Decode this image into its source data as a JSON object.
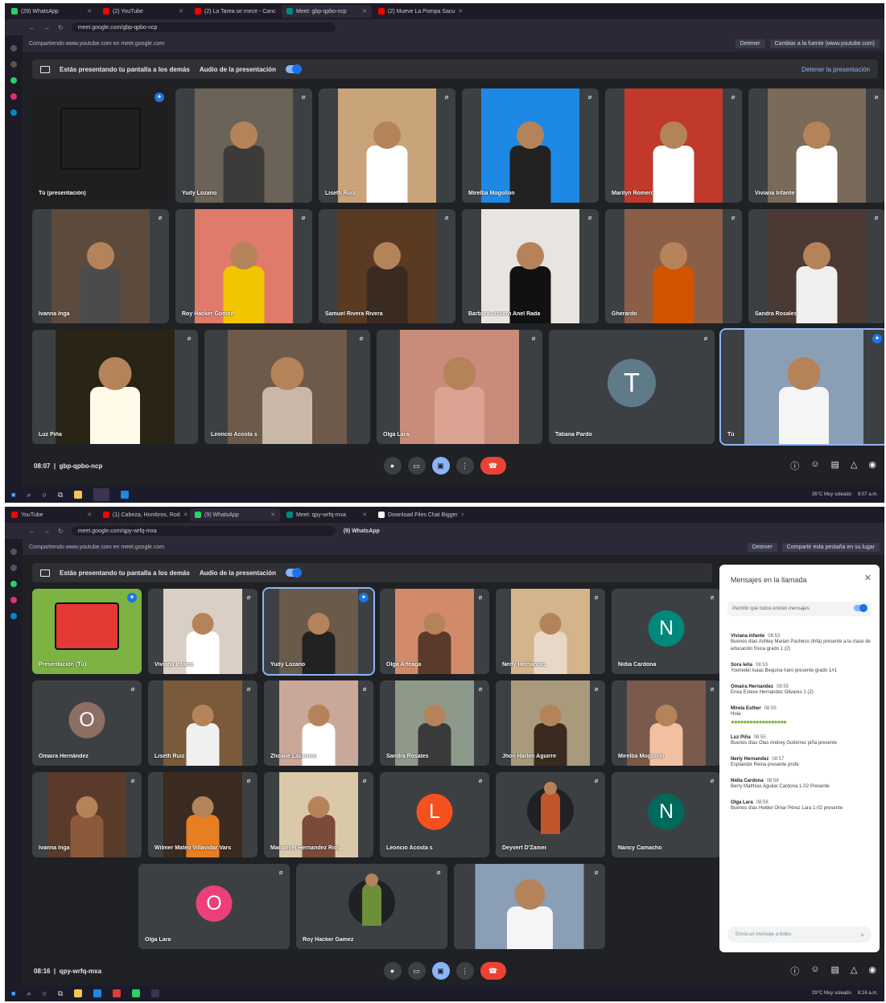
{
  "top": {
    "tabs": [
      {
        "label": "(29) WhatsApp",
        "color": "#25d366"
      },
      {
        "label": "(2) YouTube",
        "color": "#ff0000"
      },
      {
        "label": "(2) La Tarea se mece - Canc",
        "color": "#ff0000"
      },
      {
        "label": "Meet: gbp-qpbo-ncp",
        "color": "#00897b",
        "active": true
      },
      {
        "label": "(2) Mueve La Pompa Sacu",
        "color": "#ff0000"
      }
    ],
    "url": "meet.google.com/gbp-qpbo-ncp",
    "sharing_text": "Compartiendo www.youtube.com en meet.google.com",
    "stop_label": "Detener",
    "switch_label": "Cambiar a la fuente (www.youtube.com)",
    "presenting_text": "Estás presentando tu pantalla a los demás",
    "audio_text": "Audio de la presentación",
    "stop_presenting": "Detener la presentación",
    "tiles": [
      {
        "name": "Tú (presentación)",
        "bg": "#1f1f1f",
        "present": true,
        "pin": true
      },
      {
        "name": "Yudy Lozano",
        "bg": "#6b6258",
        "fig": "#3d3b39"
      },
      {
        "name": "Liseth Ruiz",
        "bg": "#c9a37a",
        "fig": "#ffffff"
      },
      {
        "name": "Mirelba Mogollon",
        "bg": "#1e88e5",
        "fig": "#222222"
      },
      {
        "name": "Marilyn Romero",
        "bg": "#c0392b",
        "fig": "#ffffff"
      },
      {
        "name": "Viviana Infante",
        "bg": "#7a6a5a",
        "fig": "#ffffff"
      },
      {
        "name": "Ivanna Inga",
        "bg": "#5c4b3d",
        "fig": "#4b4b4b"
      },
      {
        "name": "Roy Hacker Gomez",
        "bg": "#e07a6a",
        "fig": "#f2c500"
      },
      {
        "name": "Samuel Rivera Rivera",
        "bg": "#5b3a22",
        "fig": "#3a2a20"
      },
      {
        "name": "Barbara Lisbeth Anel Rada",
        "bg": "#e8e4df",
        "fig": "#111111"
      },
      {
        "name": "Gherardo",
        "bg": "#8b5e48",
        "fig": "#d35400"
      },
      {
        "name": "Sandra Rosales",
        "bg": "#4a3a33",
        "fig": "#f0f0f0"
      },
      {
        "name": "Luz Piña",
        "bg": "#2a2416",
        "fig": "#fffbe8"
      },
      {
        "name": "Leoncio Acosta s",
        "bg": "#6d5a4a",
        "fig": "#c9b8a8"
      },
      {
        "name": "Olga Lara",
        "bg": "#c98b7a",
        "fig": "#dba391"
      },
      {
        "name": "Tatiana Pardo",
        "avatar": "T",
        "avatar_color": "#5f7b88"
      },
      {
        "name": "Tú",
        "bg": "#8a9fb5",
        "fig": "#f5f5f5",
        "pin": true,
        "highlight": true
      }
    ],
    "meeting_time": "08:07",
    "meeting_code": "gbp-qpbo-ncp",
    "tray_text": "26°C  Muy soleado",
    "clock": "8:07 a.m."
  },
  "bottom": {
    "tabs": [
      {
        "label": "YouTube",
        "color": "#ff0000"
      },
      {
        "label": "(1) Cabeza, Hombros, Rod",
        "color": "#ff0000"
      },
      {
        "label": "(9) WhatsApp",
        "color": "#25d366",
        "active": true
      },
      {
        "label": "Meet: qpy-wrfq-mxa",
        "color": "#00897b"
      },
      {
        "label": "Download Files Chat Bigger",
        "color": "#ffffff"
      }
    ],
    "tab_tooltip": "(9) WhatsApp",
    "url": "meet.google.com/qpy-wrfq-mxa",
    "sharing_text": "Compartiendo www.youtube.com en meet.google.com",
    "stop_label": "Detener",
    "switch_label": "Compartir esta pestaña en su lugar",
    "presenting_text": "Estás presentando tu pantalla a los demás",
    "audio_text": "Audio de la presentación",
    "tiles": [
      {
        "name": "Presentación (Tú)",
        "bg": "#7cb342",
        "fig": "#e53935",
        "present": true,
        "pin": true
      },
      {
        "name": "Viviana Infante",
        "bg": "#d9cfc4",
        "fig": "#ffffff"
      },
      {
        "name": "Yudy Lozano",
        "bg": "#6a5a4a",
        "fig": "#222222",
        "highlight": true,
        "pin": true
      },
      {
        "name": "Olga Arteaga",
        "bg": "#d18a6a",
        "fig": "#5a3a2a"
      },
      {
        "name": "Nerly Hernandez",
        "bg": "#d4b48a",
        "fig": "#e8d8c8"
      },
      {
        "name": "Nidia Cardona",
        "avatar": "N",
        "avatar_color": "#00897b"
      },
      {
        "name": "Omaira Hernández",
        "avatar": "O",
        "avatar_color": "#8d6e63"
      },
      {
        "name": "Liseth Ruiz",
        "bg": "#7a5a3a",
        "fig": "#f0f0f0"
      },
      {
        "name": "Zhoane Lazarrino",
        "bg": "#c9a89a",
        "fig": "#ffffff"
      },
      {
        "name": "Sandra Rosales",
        "bg": "#8d9a8a",
        "fig": "#3a3a3a"
      },
      {
        "name": "Jhon Harlen Aguirre",
        "bg": "#a89a7a",
        "fig": "#3a2a20"
      },
      {
        "name": "Mirelba Mogollon",
        "bg": "#7a5a4a",
        "fig": "#f0c0a0"
      },
      {
        "name": "Ivanna Inga",
        "bg": "#5a3a2a",
        "fig": "#8b5a3a"
      },
      {
        "name": "Wilmer Mateo Villavidar Vars",
        "bg": "#3a2a20",
        "fig": "#e67e22"
      },
      {
        "name": "Marianyel Hernandez Rios",
        "bg": "#d9c9a9",
        "fig": "#7a4a3a"
      },
      {
        "name": "Leoncio Acosta s",
        "avatar": "L",
        "avatar_color": "#f4511e"
      },
      {
        "name": "Deyvert D'Zamer",
        "bg": "#202124",
        "fig": "#c0562a",
        "small": true
      },
      {
        "name": "Nancy Camacho",
        "avatar": "N",
        "avatar_color": "#00695c"
      },
      {
        "name": "Olga Lara",
        "avatar": "O",
        "avatar_color": "#ec407a"
      },
      {
        "name": "Roy Hacker Gamez",
        "bg": "#202124",
        "fig": "#6d8f3a",
        "small": true
      },
      {
        "name": "",
        "bg": "#8a9fb5",
        "fig": "#f5f5f5"
      }
    ],
    "chat": {
      "title": "Mensajes en la llamada",
      "allow_text": "Permitir que todos envíen mensajes",
      "messages": [
        {
          "who": "Viviana infante",
          "when": "08:53",
          "text": "Buenos días Ashley Marian Pacheco (Infa) presente a la clase de educación física grado 1 (2)"
        },
        {
          "who": "Sora leña",
          "when": "08:53",
          "text": "Yoonedel Isaac Bequina haro presente grado 1#1"
        },
        {
          "who": "Omaira Hernandez",
          "when": "08:55",
          "text": "Enea Esteve Hernández Olivares 1 (2)"
        },
        {
          "who": "Mirela Esther",
          "when": "08:55",
          "text": "Hola"
        },
        {
          "who": "Luz Piña",
          "when": "08:55",
          "text": "Buenos días Olas Andrey Gutiérrez piña presente"
        },
        {
          "who": "Nerly Hernandez",
          "when": "08:57",
          "text": "Esplandor Reina presente profe"
        },
        {
          "who": "Nidia Cardona",
          "when": "08:58",
          "text": "Berry Matthias Aguilar Cardona 1-02 Presente"
        },
        {
          "who": "Olga Lara",
          "when": "08:58",
          "text": "Buenos días Helder Omar Pérez Lara 1-02 presente"
        }
      ],
      "input_placeholder": "Envía un mensaje a todos"
    },
    "meeting_time": "08:16",
    "meeting_code": "qpy-wrfq-mxa",
    "tray_text": "29°C  Muy soleado",
    "clock": "8:16 a.m."
  }
}
